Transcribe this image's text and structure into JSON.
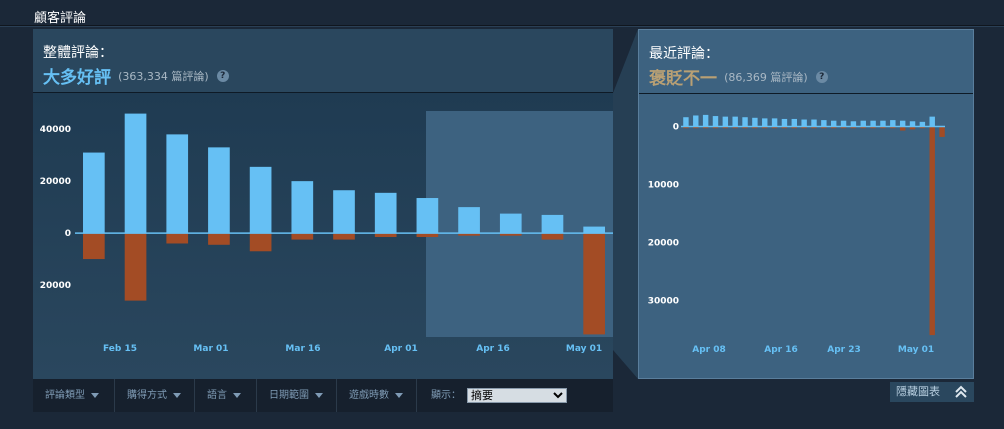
{
  "section_title": "顧客評論",
  "overall": {
    "label": "整體評論：",
    "summary": "大多好評",
    "count": "(363,334 篇評論)",
    "summary_color": "#66c0f4",
    "help_icon": "?"
  },
  "recent": {
    "label": "最近評論：",
    "summary": "褒貶不一",
    "count": "(86,369 篇評論)",
    "summary_color": "#b9a074",
    "help_icon": "?"
  },
  "filters": [
    {
      "label": "評論類型"
    },
    {
      "label": "購得方式"
    },
    {
      "label": "語言"
    },
    {
      "label": "日期範圍"
    },
    {
      "label": "遊戲時數"
    }
  ],
  "display": {
    "label": "顯示：",
    "value": "摘要"
  },
  "hide_button": {
    "label": "隱藏圖表"
  },
  "colors": {
    "positive": "#66c0f4",
    "negative": "#a34c25",
    "highlight": "#3d6280"
  },
  "chart_data": [
    {
      "type": "bar",
      "name": "overall",
      "yticks": [
        {
          "value": 40000,
          "label": "40000"
        },
        {
          "value": 20000,
          "label": "20000"
        },
        {
          "value": 0,
          "label": "0"
        },
        {
          "value": -20000,
          "label": "20000"
        }
      ],
      "ylim": [
        -40000,
        47000
      ],
      "xticks": [
        "Feb 15",
        "Mar 01",
        "Mar 16",
        "Apr 01",
        "Apr 16",
        "May 01"
      ],
      "series": [
        {
          "values": [
            31000,
            46000,
            38000,
            33000,
            25500,
            20000,
            16500,
            15500,
            13500,
            10000,
            7500,
            7000,
            2500
          ]
        },
        {
          "values": [
            -10000,
            -26000,
            -4000,
            -4500,
            -7000,
            -2500,
            -2500,
            -1500,
            -1500,
            -1000,
            -1000,
            -2500,
            -39000
          ]
        }
      ]
    },
    {
      "type": "bar",
      "name": "recent",
      "yticks": [
        {
          "value": 0,
          "label": "0"
        },
        {
          "value": -10000,
          "label": "10000"
        },
        {
          "value": -20000,
          "label": "20000"
        },
        {
          "value": -30000,
          "label": "30000"
        }
      ],
      "ylim": [
        -36500,
        2500
      ],
      "xticks": [
        "Apr 08",
        "Apr 16",
        "Apr 23",
        "May 01"
      ],
      "series": [
        {
          "values": [
            1600,
            1900,
            2000,
            1800,
            1700,
            1700,
            1600,
            1500,
            1400,
            1400,
            1300,
            1300,
            1200,
            1200,
            1100,
            1000,
            1000,
            900,
            1000,
            1000,
            1000,
            1100,
            1000,
            900,
            800,
            1700,
            0
          ]
        },
        {
          "values": [
            -300,
            -300,
            -300,
            -300,
            -300,
            -300,
            -300,
            -300,
            -300,
            -300,
            -300,
            -300,
            -300,
            -300,
            -300,
            -300,
            -300,
            -300,
            -300,
            -300,
            -300,
            -300,
            -700,
            -500,
            -300,
            -36000,
            -1800
          ]
        }
      ]
    }
  ]
}
